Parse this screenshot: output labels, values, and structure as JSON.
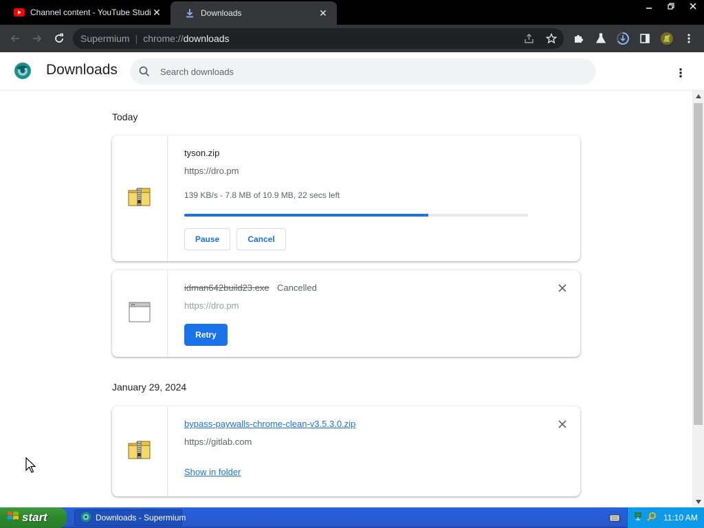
{
  "tabs": [
    {
      "title": "Channel content - YouTube Studio",
      "favicon": "youtube-icon"
    },
    {
      "title": "Downloads",
      "favicon": "download-icon",
      "active": true
    }
  ],
  "toolbar": {
    "omnibox": {
      "brand": "Supermium",
      "scheme": "chrome://",
      "host": "downloads",
      "path": ""
    }
  },
  "page": {
    "title": "Downloads",
    "search_placeholder": "Search downloads"
  },
  "groups": [
    {
      "date": "Today",
      "items": [
        {
          "filename": "tyson.zip",
          "url": "https://dro.pm",
          "progress_text": "139 KB/s - 7.8 MB of 10.9 MB, 22 secs left",
          "progress_fraction": 0.71,
          "buttons": [
            "Pause",
            "Cancel"
          ]
        },
        {
          "filename": "idman642build23.exe",
          "status": "Cancelled",
          "url": "https://dro.pm",
          "buttons": [
            "Retry"
          ]
        }
      ]
    },
    {
      "date": "January 29, 2024",
      "items": [
        {
          "filename": "bypass-paywalls-chrome-clean-v3.5.3.0.zip",
          "url": "https://gitlab.com",
          "link": "Show in folder"
        }
      ]
    }
  ],
  "taskbar": {
    "start_label": "start",
    "task_label": "Downloads - Supermium",
    "clock": "11:10 AM"
  },
  "colors": {
    "accent": "#1a73e8",
    "titlebar": "#000000",
    "toolbar": "#35363a",
    "omnibox": "#202124"
  }
}
